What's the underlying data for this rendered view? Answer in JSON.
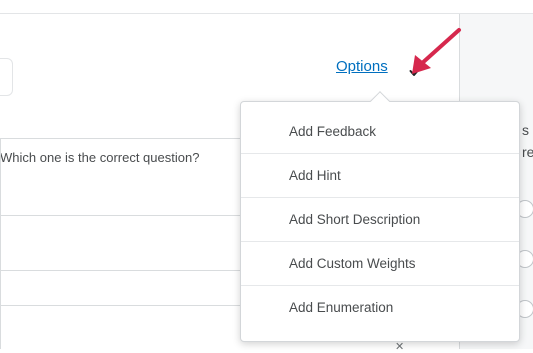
{
  "header": {
    "options_label": "Options"
  },
  "question": {
    "prompt": "Which one is the correct question?"
  },
  "options_menu": {
    "items": [
      {
        "label": "Add Feedback"
      },
      {
        "label": "Add Hint"
      },
      {
        "label": "Add Short Description"
      },
      {
        "label": "Add Custom Weights"
      },
      {
        "label": "Add Enumeration"
      }
    ]
  },
  "right_panel": {
    "fragment_1": "s i",
    "fragment_2": "re"
  },
  "colors": {
    "link": "#006fbf",
    "arrow_annotation": "#d6284d",
    "menu_border": "#d3d6d9",
    "text": "#494c4e"
  }
}
